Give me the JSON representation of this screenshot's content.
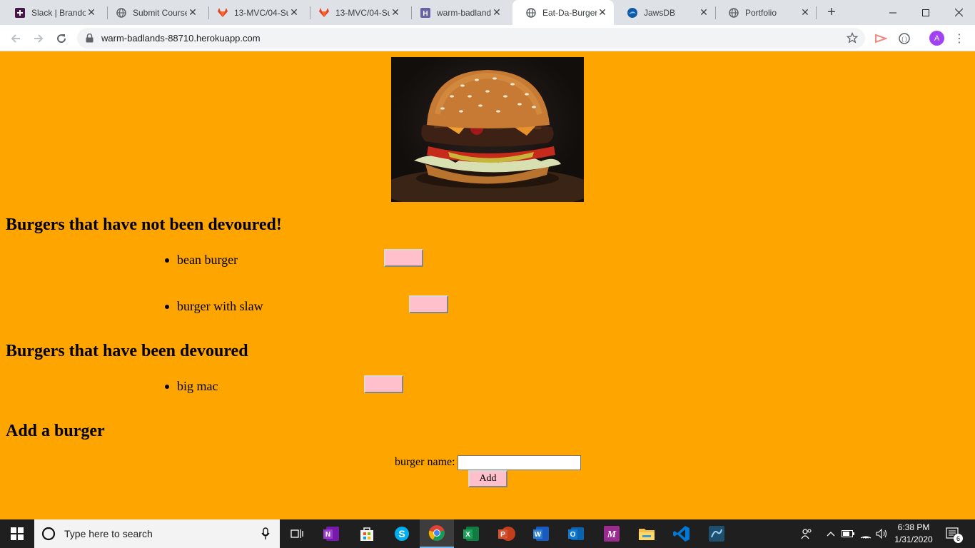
{
  "browser": {
    "tabs": [
      {
        "title": "Slack | Brandon",
        "icon": "slack-icon",
        "active": false
      },
      {
        "title": "Submit Course",
        "icon": "globe-icon",
        "active": false
      },
      {
        "title": "13-MVC/04-Su",
        "icon": "gitlab-icon",
        "active": false
      },
      {
        "title": "13-MVC/04-Su",
        "icon": "gitlab-icon",
        "active": false
      },
      {
        "title": "warm-badland",
        "icon": "heroku-icon",
        "active": false
      },
      {
        "title": "Eat-Da-Burger",
        "icon": "globe-icon",
        "active": true
      },
      {
        "title": "JawsDB",
        "icon": "jawsdb-icon",
        "active": false
      },
      {
        "title": "Portfolio",
        "icon": "globe-icon",
        "active": false
      }
    ],
    "url": "warm-badlands-88710.herokuapp.com",
    "profile_initial": "A"
  },
  "page": {
    "not_devoured_heading": "Burgers that have not been devoured!",
    "not_devoured": [
      {
        "name": "bean burger"
      },
      {
        "name": "burger with slaw"
      }
    ],
    "devoured_heading": "Burgers that have been devoured",
    "devoured": [
      {
        "name": "big mac"
      }
    ],
    "add_heading": "Add a burger",
    "form": {
      "label": "burger name:",
      "value": "",
      "submit_label": "Add"
    }
  },
  "taskbar": {
    "search_placeholder": "Type here to search",
    "time": "6:38 PM",
    "date": "1/31/2020",
    "notification_count": "6"
  },
  "colors": {
    "page_background": "#ffa500",
    "button_background": "#ffc0cb"
  }
}
